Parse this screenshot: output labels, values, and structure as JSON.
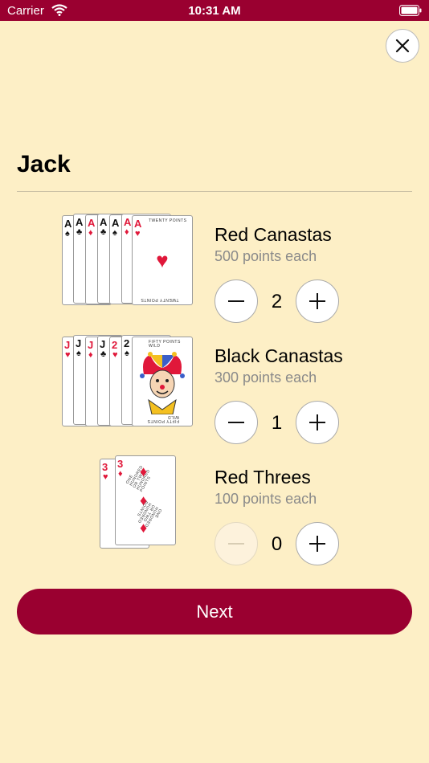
{
  "status_bar": {
    "carrier": "Carrier",
    "time": "10:31 AM"
  },
  "player": {
    "name": "Jack"
  },
  "rows": [
    {
      "title": "Red Canastas",
      "subtitle": "500 points each",
      "value": "2",
      "card_text_top": "TWENTY POINTS",
      "card_text_bottom": "TWENTY POINTS"
    },
    {
      "title": "Black Canastas",
      "subtitle": "300 points each",
      "value": "1",
      "card_text_top": "FIFTY POINTS WILD",
      "card_text_bottom": "FIFTY POINTS WILD"
    },
    {
      "title": "Red Threes",
      "subtitle": "100 points each",
      "value": "0",
      "card_text_top": "ONE HUNDRED OR TWO HUNDRED POINTS",
      "card_text_bottom": "ONE HUNDRED OR TWO HUNDRED POINTS"
    }
  ],
  "actions": {
    "next_label": "Next"
  },
  "colors": {
    "accent": "#9a0030",
    "background": "#fdefc6"
  }
}
